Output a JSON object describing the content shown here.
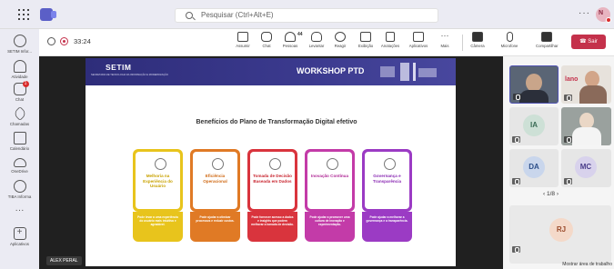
{
  "header": {
    "search_placeholder": "Pesquisar (Ctrl+Alt+E)",
    "more": "···",
    "me_initials": "N"
  },
  "rail": {
    "items": [
      {
        "label": "SETIM Infor...",
        "icon": "app-icon"
      },
      {
        "label": "Atividade",
        "icon": "bell-icon"
      },
      {
        "label": "Chat",
        "icon": "chat-icon",
        "badge": "1"
      },
      {
        "label": "Chamadas",
        "icon": "phone-icon"
      },
      {
        "label": "Calendário",
        "icon": "calendar-icon"
      },
      {
        "label": "OneDrive",
        "icon": "cloud-icon"
      },
      {
        "label": "TIBA Informa",
        "icon": "app-icon"
      },
      {
        "label": "···",
        "icon": "more-icon"
      },
      {
        "label": "Aplicativos",
        "icon": "apps-icon"
      }
    ]
  },
  "meeting": {
    "timer": "33:24",
    "participants_count": "44",
    "tools": [
      {
        "label": "Assumir",
        "icon": "take-control-icon"
      },
      {
        "label": "Chat",
        "icon": "chat-icon"
      },
      {
        "label": "Pessoas",
        "icon": "people-icon"
      },
      {
        "label": "Levantar",
        "icon": "raise-hand-icon"
      },
      {
        "label": "Reagir",
        "icon": "react-icon"
      },
      {
        "label": "Exibição",
        "icon": "view-icon"
      },
      {
        "label": "Anotações",
        "icon": "notes-icon"
      },
      {
        "label": "Aplicativos",
        "icon": "apps-icon"
      },
      {
        "label": "Mais",
        "icon": "more-icon"
      }
    ],
    "devices": [
      {
        "label": "Câmera",
        "icon": "camera-off-icon"
      },
      {
        "label": "Microfone",
        "icon": "mic-off-icon"
      },
      {
        "label": "Compartilhar",
        "icon": "share-icon"
      }
    ],
    "leave_label": "Sair"
  },
  "slide": {
    "org": "SETIM",
    "org_sub": "SECRETARIA DE TECNOLOGIA DA INFORMAÇÃO E MODERNIZAÇÃO",
    "event": "WORKSHOP PTD",
    "title": "Benefícios do Plano de Transformação Digital efetivo",
    "cards": [
      {
        "title": "Melhoria na Experiência do Usuário",
        "desc": "Pode levar a uma experiência do usuário mais intuitiva e agradável.",
        "color": "#e8c41c",
        "icon": "user-icon"
      },
      {
        "title": "Eficiência Operacional",
        "desc": "Pode ajudar a otimizar processos e reduzir custos.",
        "color": "#e07a25",
        "icon": "gear-icon"
      },
      {
        "title": "Tomada de Decisão Baseada em Dados",
        "desc": "Pode fornecer acesso a dados e insights que podem melhorar a tomada de decisão.",
        "color": "#d9343d",
        "icon": "chart-icon"
      },
      {
        "title": "Inovação Contínua",
        "desc": "Pode ajudar a promover uma cultura de inovação e experimentação.",
        "color": "#c33ba8",
        "icon": "lightbulb-icon"
      },
      {
        "title": "Governança e Transparência",
        "desc": "Pode ajudar a melhorar a governança e a transparência.",
        "color": "#9b3bc4",
        "icon": "scales-icon"
      }
    ],
    "presenter": "ALEX PERAL"
  },
  "panel": {
    "participants": [
      {
        "initials": "IA"
      },
      {
        "initials": "DA"
      },
      {
        "initials": "MC"
      },
      {
        "initials": "RJ"
      }
    ],
    "logo_text": "lano",
    "pager": "1/8",
    "show_workarea": "Mostrar área de trabalho"
  }
}
